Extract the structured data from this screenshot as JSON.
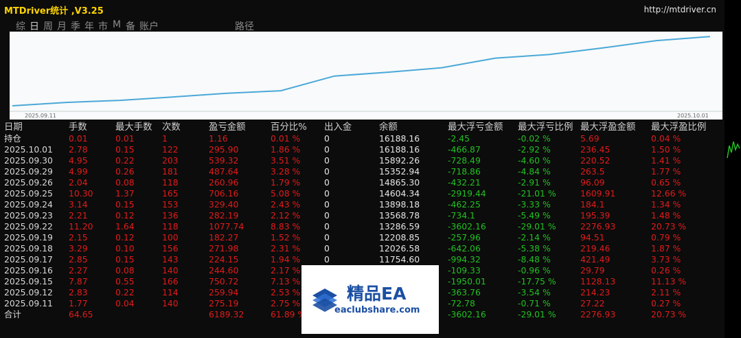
{
  "app": {
    "title": "MTDriver统计 ,V3.25",
    "url": "http://mtdriver.cn",
    "tabs": [
      "综",
      "日",
      "周",
      "月",
      "季",
      "年",
      "市",
      "M",
      "备",
      "账户"
    ],
    "active_tab": "日",
    "path_tab": "路径"
  },
  "chart": {
    "start_label": "2025.09.11",
    "end_label": "2025.10.01",
    "line_color": "#4aa8d8",
    "balance_values": [
      12026.58,
      11754.6,
      11754.6,
      12026.58,
      12208.85,
      13286.59,
      13568.78,
      13898.18,
      14604.34,
      14865.3,
      15352.94,
      15892.26,
      16188.16
    ]
  },
  "table": {
    "headers": [
      "日期",
      "手数",
      "最大手数",
      "次数",
      "盈亏金额",
      "百分比%",
      "出入金",
      "余额",
      "最大浮亏金额",
      "最大浮亏比例",
      "最大浮盈金额",
      "最大浮盈比例"
    ],
    "rows": [
      [
        "持仓",
        "0.01",
        "0.01",
        "1",
        "1.16",
        "0.01 %",
        "0",
        "16188.16",
        "-2.45",
        "-0.02 %",
        "5.69",
        "0.04 %"
      ],
      [
        "2025.10.01",
        "2.78",
        "0.15",
        "122",
        "295.90",
        "1.86 %",
        "0",
        "16188.16",
        "-466.87",
        "-2.92 %",
        "236.45",
        "1.50 %"
      ],
      [
        "2025.09.30",
        "4.95",
        "0.22",
        "203",
        "539.32",
        "3.51 %",
        "0",
        "15892.26",
        "-728.49",
        "-4.60 %",
        "220.52",
        "1.41 %"
      ],
      [
        "2025.09.29",
        "4.99",
        "0.26",
        "181",
        "487.64",
        "3.28 %",
        "0",
        "15352.94",
        "-718.86",
        "-4.84 %",
        "263.5",
        "1.77 %"
      ],
      [
        "2025.09.26",
        "2.04",
        "0.08",
        "118",
        "260.96",
        "1.79 %",
        "0",
        "14865.30",
        "-432.21",
        "-2.91 %",
        "96.09",
        "0.65 %"
      ],
      [
        "2025.09.25",
        "10.30",
        "1.37",
        "165",
        "706.16",
        "5.08 %",
        "0",
        "14604.34",
        "-2919.44",
        "-21.01 %",
        "1609.91",
        "12.66 %"
      ],
      [
        "2025.09.24",
        "3.14",
        "0.15",
        "153",
        "329.40",
        "2.43 %",
        "0",
        "13898.18",
        "-462.25",
        "-3.33 %",
        "184.1",
        "1.34 %"
      ],
      [
        "2025.09.23",
        "2.21",
        "0.12",
        "136",
        "282.19",
        "2.12 %",
        "0",
        "13568.78",
        "-734.1",
        "-5.49 %",
        "195.39",
        "1.48 %"
      ],
      [
        "2025.09.22",
        "11.20",
        "1.64",
        "118",
        "1077.74",
        "8.83 %",
        "0",
        "13286.59",
        "-3602.16",
        "-29.01 %",
        "2276.93",
        "20.73 %"
      ],
      [
        "2025.09.19",
        "2.15",
        "0.12",
        "100",
        "182.27",
        "1.52 %",
        "0",
        "12208.85",
        "-257.96",
        "-2.14 %",
        "94.51",
        "0.79 %"
      ],
      [
        "2025.09.18",
        "3.29",
        "0.10",
        "156",
        "271.98",
        "2.31 %",
        "0",
        "12026.58",
        "-642.06",
        "-5.38 %",
        "219.46",
        "1.87 %"
      ],
      [
        "2025.09.17",
        "2.85",
        "0.15",
        "143",
        "224.15",
        "1.94 %",
        "0",
        "11754.60",
        "-994.32",
        "-8.48 %",
        "421.49",
        "3.73 %"
      ],
      [
        "2025.09.16",
        "2.27",
        "0.08",
        "140",
        "244.60",
        "2.17 %",
        "",
        "",
        "-109.33",
        "-0.96 %",
        "29.79",
        "0.26 %"
      ],
      [
        "2025.09.15",
        "7.87",
        "0.55",
        "166",
        "750.72",
        "7.13 %",
        "",
        "",
        "-1950.01",
        "-17.75 %",
        "1128.13",
        "11.13 %"
      ],
      [
        "2025.09.12",
        "2.83",
        "0.22",
        "114",
        "259.94",
        "2.53 %",
        "",
        "",
        "-363.76",
        "-3.54 %",
        "214.23",
        "2.11 %"
      ],
      [
        "2025.09.11",
        "1.77",
        "0.04",
        "140",
        "275.19",
        "2.75 %",
        "",
        "",
        "-72.78",
        "-0.71 %",
        "27.22",
        "0.27 %"
      ]
    ],
    "total": [
      "合计",
      "64.65",
      "",
      "",
      "6189.32",
      "61.89 %",
      "",
      "",
      "-3602.16",
      "-29.01 %",
      "2276.93",
      "20.73 %"
    ]
  },
  "watermark": {
    "title": "精品EA",
    "url": "eaclubshare.com"
  }
}
